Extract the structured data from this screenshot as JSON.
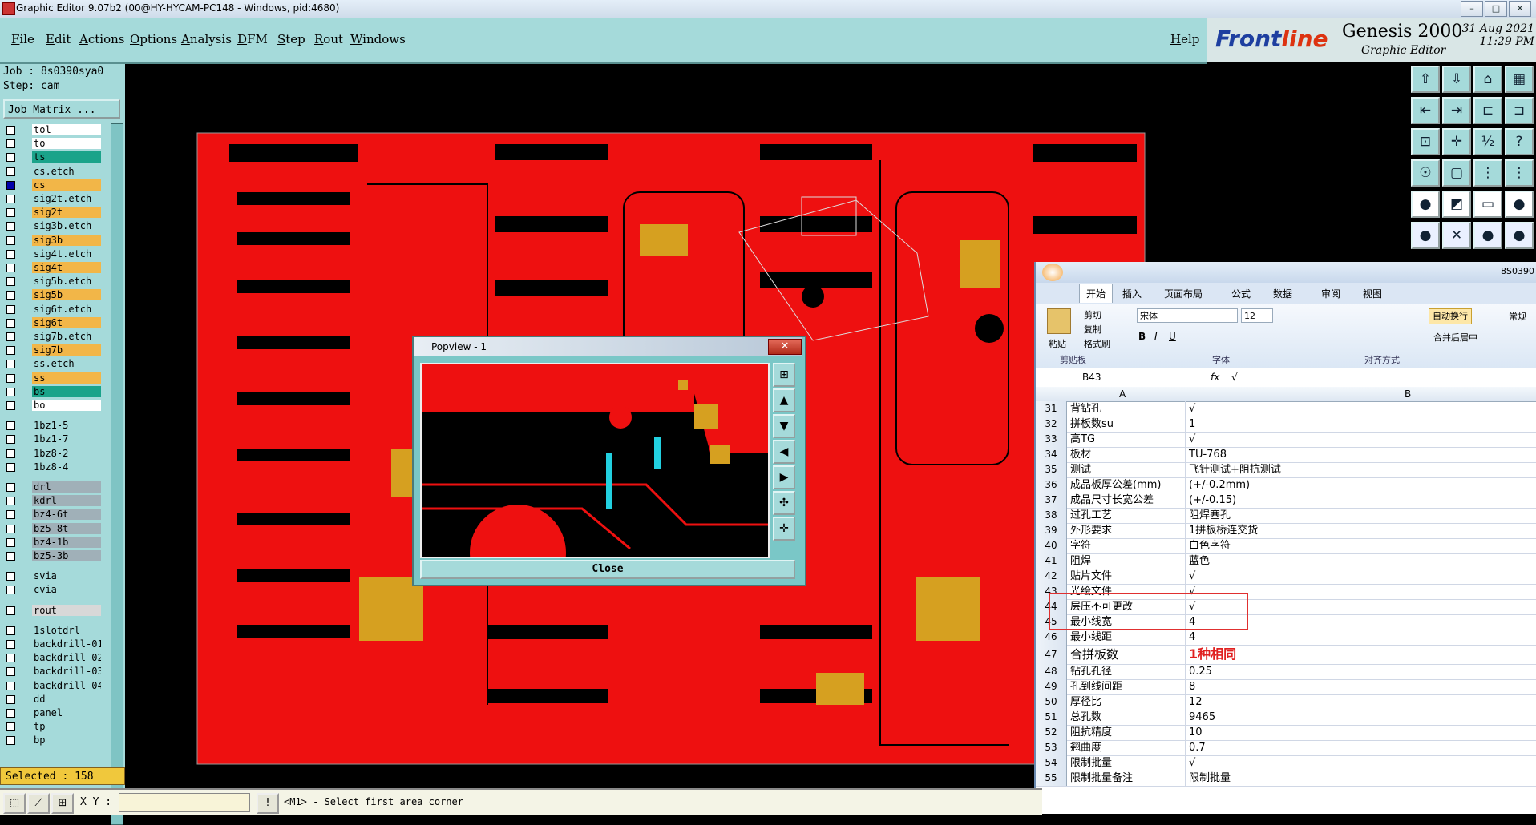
{
  "window": {
    "title": "Graphic Editor 9.07b2 (00@HY-HYCAM-PC148 - Windows, pid:4680)",
    "min": "–",
    "max": "□",
    "close": "✕"
  },
  "menu": [
    "File",
    "Edit",
    "Actions",
    "Options",
    "Analysis",
    "DFM",
    "Step",
    "Rout",
    "Windows"
  ],
  "help": "Help",
  "brand": {
    "logo_a": "Front",
    "logo_b": "line",
    "product": "Genesis 2000",
    "sub": "Graphic Editor",
    "date": "31 Aug 2021",
    "time": "11:29 PM"
  },
  "job": {
    "job": "Job : 8s0390sya0",
    "step": "Step: cam",
    "matrix_btn": "Job Matrix ..."
  },
  "layers": [
    {
      "name": "tol",
      "color": "#ffffff",
      "checked": false
    },
    {
      "name": "to",
      "color": "#ffffff",
      "checked": false
    },
    {
      "name": "ts",
      "color": "#1aa38a",
      "checked": false
    },
    {
      "name": "cs.etch",
      "color": "#a5dada",
      "checked": false
    },
    {
      "name": "cs",
      "color": "#f2b648",
      "checked": true
    },
    {
      "name": "sig2t.etch",
      "color": "#a5dada",
      "checked": false
    },
    {
      "name": "sig2t",
      "color": "#f2b648",
      "checked": false
    },
    {
      "name": "sig3b.etch",
      "color": "#a5dada",
      "checked": false
    },
    {
      "name": "sig3b",
      "color": "#f2b648",
      "checked": false
    },
    {
      "name": "sig4t.etch",
      "color": "#a5dada",
      "checked": false
    },
    {
      "name": "sig4t",
      "color": "#f2b648",
      "checked": false
    },
    {
      "name": "sig5b.etch",
      "color": "#a5dada",
      "checked": false
    },
    {
      "name": "sig5b",
      "color": "#f2b648",
      "checked": false
    },
    {
      "name": "sig6t.etch",
      "color": "#a5dada",
      "checked": false
    },
    {
      "name": "sig6t",
      "color": "#f2b648",
      "checked": false
    },
    {
      "name": "sig7b.etch",
      "color": "#a5dada",
      "checked": false
    },
    {
      "name": "sig7b",
      "color": "#f2b648",
      "checked": false
    },
    {
      "name": "ss.etch",
      "color": "#a5dada",
      "checked": false
    },
    {
      "name": "ss",
      "color": "#f2b648",
      "checked": false
    },
    {
      "name": "bs",
      "color": "#1aa38a",
      "checked": false
    },
    {
      "name": "bo",
      "color": "#ffffff",
      "checked": false
    },
    {
      "name": "1bz1-5",
      "color": "#a5dada",
      "checked": false
    },
    {
      "name": "1bz1-7",
      "color": "#a5dada",
      "checked": false
    },
    {
      "name": "1bz8-2",
      "color": "#a5dada",
      "checked": false
    },
    {
      "name": "1bz8-4",
      "color": "#a5dada",
      "checked": false
    },
    {
      "name": "drl",
      "color": "#a0b0b8",
      "checked": false
    },
    {
      "name": "kdrl",
      "color": "#a0b0b8",
      "checked": false
    },
    {
      "name": "bz4-6t",
      "color": "#a0b0b8",
      "checked": false
    },
    {
      "name": "bz5-8t",
      "color": "#a0b0b8",
      "checked": false
    },
    {
      "name": "bz4-1b",
      "color": "#a0b0b8",
      "checked": false
    },
    {
      "name": "bz5-3b",
      "color": "#a0b0b8",
      "checked": false
    },
    {
      "name": "svia",
      "color": "#a5dada",
      "checked": false
    },
    {
      "name": "cvia",
      "color": "#a5dada",
      "checked": false
    },
    {
      "name": "rout",
      "color": "#d8d8d8",
      "checked": false
    },
    {
      "name": "1slotdrl",
      "color": "#a5dada",
      "checked": false
    },
    {
      "name": "backdrill-01",
      "color": "#a5dada",
      "checked": false
    },
    {
      "name": "backdrill-02",
      "color": "#a5dada",
      "checked": false
    },
    {
      "name": "backdrill-03",
      "color": "#a5dada",
      "checked": false
    },
    {
      "name": "backdrill-04",
      "color": "#a5dada",
      "checked": false
    },
    {
      "name": "dd",
      "color": "#a5dada",
      "checked": false
    },
    {
      "name": "panel",
      "color": "#a5dada",
      "checked": false
    },
    {
      "name": "tp",
      "color": "#a5dada",
      "checked": false
    },
    {
      "name": "bp",
      "color": "#a5dada",
      "checked": false
    }
  ],
  "selected": "Selected : 158",
  "status": {
    "xy_label": "X Y :",
    "prompt": "<M1> - Select first area corner",
    "warn": "!"
  },
  "popview": {
    "title": "Popview - 1",
    "close_x": "✕",
    "close_btn": "Close"
  },
  "excel": {
    "doc_id": "8S0390",
    "tabs": [
      "开始",
      "插入",
      "页面布局",
      "公式",
      "数据",
      "审阅",
      "视图"
    ],
    "clipboard": {
      "paste": "粘贴",
      "cut": "剪切",
      "copy": "复制",
      "format": "格式刷",
      "group": "剪贴板"
    },
    "font": {
      "name": "宋体",
      "size": "12",
      "group": "字体"
    },
    "align": {
      "wrap": "自动换行",
      "merge": "合并后居中",
      "group": "对齐方式"
    },
    "number": {
      "general": "常规"
    },
    "name_box": "B43",
    "formula": "√",
    "cols": [
      "A",
      "B"
    ],
    "rows": [
      {
        "n": "31",
        "a": "背钻孔",
        "b": "√"
      },
      {
        "n": "32",
        "a": "拼板数su",
        "b": "1"
      },
      {
        "n": "33",
        "a": "高TG",
        "b": "√"
      },
      {
        "n": "34",
        "a": "板材",
        "b": "TU-768"
      },
      {
        "n": "35",
        "a": "测试",
        "b": "飞针测试+阻抗测试"
      },
      {
        "n": "36",
        "a": "成品板厚公差(mm)",
        "b": "(+/-0.2mm)"
      },
      {
        "n": "37",
        "a": "成品尺寸长宽公差",
        "b": "(+/-0.15)"
      },
      {
        "n": "38",
        "a": "过孔工艺",
        "b": "阻焊塞孔"
      },
      {
        "n": "39",
        "a": "外形要求",
        "b": "1拼板桥连交货"
      },
      {
        "n": "40",
        "a": "字符",
        "b": "白色字符"
      },
      {
        "n": "41",
        "a": "阻焊",
        "b": "蓝色"
      },
      {
        "n": "42",
        "a": "贴片文件",
        "b": "√"
      },
      {
        "n": "43",
        "a": "光绘文件",
        "b": "√"
      },
      {
        "n": "44",
        "a": "层压不可更改",
        "b": "√"
      },
      {
        "n": "45",
        "a": "最小线宽",
        "b": "4"
      },
      {
        "n": "46",
        "a": "最小线距",
        "b": "4"
      },
      {
        "n": "47",
        "a": "合拼板数",
        "b": "1种相同"
      },
      {
        "n": "48",
        "a": "钻孔孔径",
        "b": "0.25"
      },
      {
        "n": "49",
        "a": "孔到线间距",
        "b": "8"
      },
      {
        "n": "50",
        "a": "厚径比",
        "b": "12"
      },
      {
        "n": "51",
        "a": "总孔数",
        "b": "9465"
      },
      {
        "n": "52",
        "a": "阻抗精度",
        "b": "10"
      },
      {
        "n": "53",
        "a": "翘曲度",
        "b": "0.7"
      },
      {
        "n": "54",
        "a": "限制批量",
        "b": "√"
      },
      {
        "n": "55",
        "a": "限制批量备注",
        "b": "限制批量"
      }
    ]
  }
}
